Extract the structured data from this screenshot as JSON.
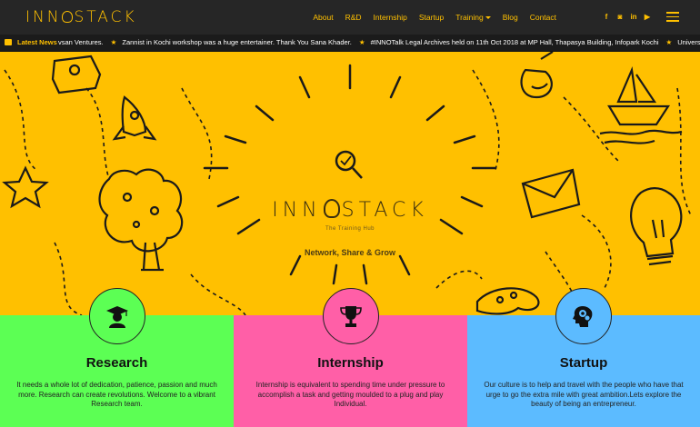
{
  "header": {
    "logo_left": "INN",
    "logo_right": "STACK",
    "nav": [
      {
        "label": "About"
      },
      {
        "label": "R&D"
      },
      {
        "label": "Internship"
      },
      {
        "label": "Startup"
      },
      {
        "label": "Training"
      },
      {
        "label": "Blog"
      },
      {
        "label": "Contact"
      }
    ],
    "social": [
      {
        "icon": "facebook-icon",
        "glyph": "f"
      },
      {
        "icon": "instagram-icon",
        "glyph": "◙"
      },
      {
        "icon": "linkedin-icon",
        "glyph": "in"
      },
      {
        "icon": "youtube-icon",
        "glyph": "▶"
      }
    ]
  },
  "ticker": {
    "label": "Latest News",
    "items": [
      "vsan Ventures.",
      "Zannist in Kochi workshop was a huge entertainer. Thank You Sana Khader.",
      "#INNOTalk Legal Archives held on 11th Oct 2018 at MP Hall, Thapasya Building, Infopark Kochi",
      "Univers"
    ]
  },
  "hero": {
    "title_left": "INN",
    "title_right": "STACK",
    "subtitle": "The Training Hub",
    "tagline": "Network, Share & Grow"
  },
  "cards": [
    {
      "title": "Research",
      "text": "It needs a whole lot of dedication, patience, passion and much more. Research can create revolutions. Welcome to a vibrant Research team."
    },
    {
      "title": "Internship",
      "text": "Internship is equivalent to spending time under pressure to accomplish a task and getting moulded to a plug and play Individual."
    },
    {
      "title": "Startup",
      "text": "Our culture is to help and travel with the people who have that urge to go the extra mile with great ambition.Lets explore the beauty of being an entrepreneur."
    }
  ],
  "colors": {
    "brand_yellow": "#ffc000",
    "header_dark": "#262626",
    "research_green": "#5cff54",
    "internship_pink": "#ff5fa7",
    "startup_blue": "#5cbbff"
  }
}
